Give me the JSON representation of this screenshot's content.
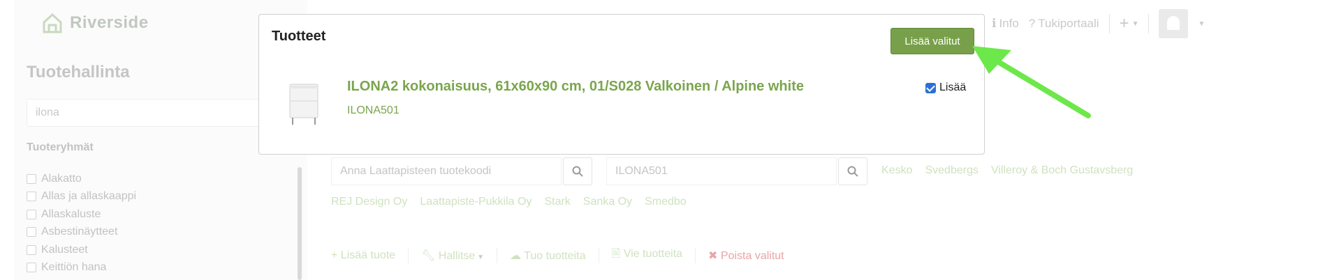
{
  "app": {
    "logo_text": "Riverside"
  },
  "sidebar": {
    "title": "Tuotehallinta",
    "search_value": "ilona",
    "section_title": "Tuoteryhmät",
    "categories": [
      "Alakatto",
      "Allas ja allaskaappi",
      "Allaskaluste",
      "Asbestinäytteet",
      "Kalusteet",
      "Keittiön hana"
    ]
  },
  "topnav": {
    "info": "Info",
    "support": "Tukiportaali"
  },
  "filters": {
    "code_placeholder": "Anna Laattapisteen tuotekoodi",
    "code_value": "ILONA501"
  },
  "suppliers": {
    "row1": [
      "Kesko",
      "Svedbergs",
      "Villeroy & Boch Gustavsberg"
    ],
    "row2": [
      "REJ Design Oy",
      "Laattapiste-Pukkila Oy",
      "Stark",
      "Sanka Oy",
      "Smedbo"
    ]
  },
  "actions": {
    "add_product": "Lisää tuote",
    "manage": "Hallitse",
    "import": "Tuo tuotteita",
    "export": "Vie tuotteita",
    "delete_selected": "Poista valitut"
  },
  "modal": {
    "title": "Tuotteet",
    "add_selected": "Lisää valitut",
    "product": {
      "name": "ILONA2 kokonaisuus, 61x60x90 cm, 01/S028 Valkoinen / Alpine white",
      "code": "ILONA501",
      "add_label": "Lisää",
      "checked": true
    }
  },
  "colors": {
    "accent_green": "#78a04a",
    "product_green": "#7aa54d",
    "arrow_green": "#6de84a"
  }
}
